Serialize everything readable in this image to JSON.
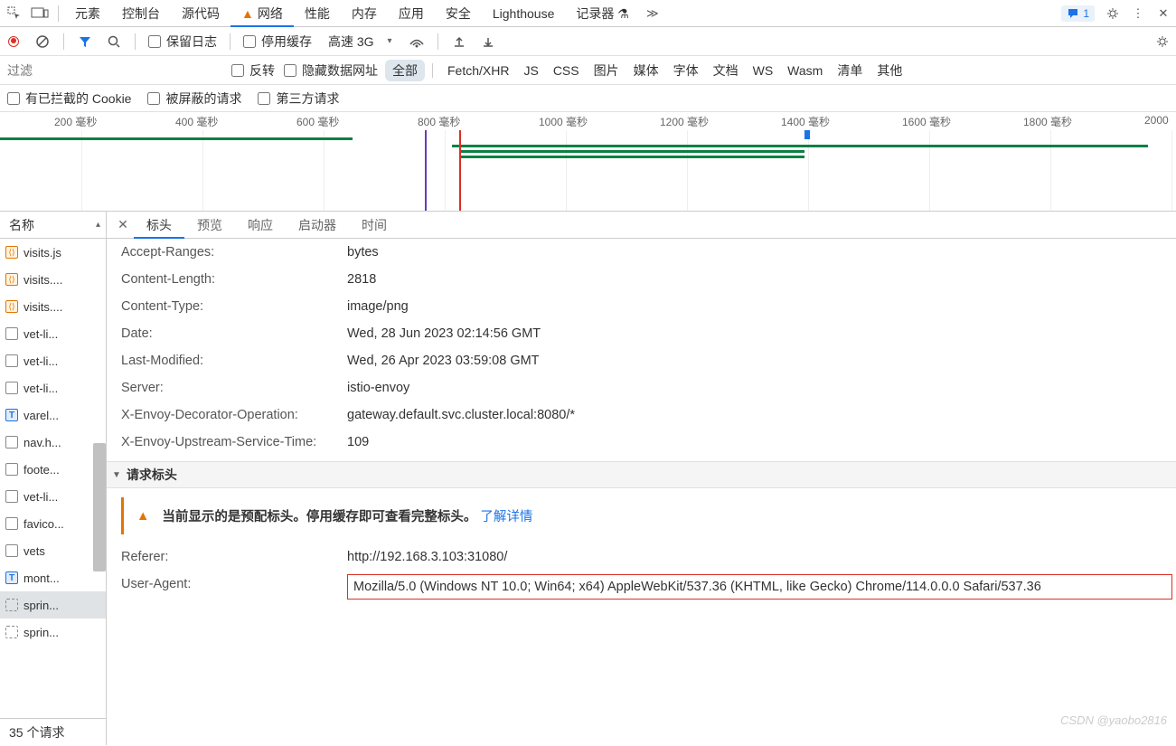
{
  "topTabs": {
    "items": [
      "元素",
      "控制台",
      "源代码",
      "网络",
      "性能",
      "内存",
      "应用",
      "安全",
      "Lighthouse",
      "记录器"
    ],
    "activeIndex": 3,
    "msgCount": "1"
  },
  "toolbar": {
    "preserveLog": "保留日志",
    "disableCache": "停用缓存",
    "throttle": "高速 3G"
  },
  "filterBar": {
    "placeholder": "过滤",
    "invert": "反转",
    "hideData": "隐藏数据网址",
    "types": [
      "全部",
      "Fetch/XHR",
      "JS",
      "CSS",
      "图片",
      "媒体",
      "字体",
      "文档",
      "WS",
      "Wasm",
      "清单",
      "其他"
    ],
    "activeType": 0
  },
  "cbRow": {
    "blockedCookies": "有已拦截的 Cookie",
    "blockedReq": "被屏蔽的请求",
    "thirdParty": "第三方请求"
  },
  "timeline": {
    "ticks": [
      "200 毫秒",
      "400 毫秒",
      "600 毫秒",
      "800 毫秒",
      "1000 毫秒",
      "1200 毫秒",
      "1400 毫秒",
      "1600 毫秒",
      "1800 毫秒",
      "2000"
    ]
  },
  "nameCol": {
    "header": "名称",
    "footer": "35 个请求",
    "items": [
      {
        "icon": "js",
        "label": "visits.js"
      },
      {
        "icon": "js",
        "label": "visits...."
      },
      {
        "icon": "js",
        "label": "visits...."
      },
      {
        "icon": "css",
        "label": "vet-li..."
      },
      {
        "icon": "css",
        "label": "vet-li..."
      },
      {
        "icon": "css",
        "label": "vet-li..."
      },
      {
        "icon": "txt",
        "label": "varel..."
      },
      {
        "icon": "css",
        "label": "nav.h..."
      },
      {
        "icon": "css",
        "label": "foote..."
      },
      {
        "icon": "css",
        "label": "vet-li..."
      },
      {
        "icon": "css",
        "label": "favico..."
      },
      {
        "icon": "css",
        "label": "vets"
      },
      {
        "icon": "txt",
        "label": "mont..."
      },
      {
        "icon": "img",
        "label": "sprin...",
        "sel": true
      },
      {
        "icon": "img",
        "label": "sprin..."
      }
    ]
  },
  "detail": {
    "tabs": [
      "标头",
      "预览",
      "响应",
      "启动器",
      "时间"
    ],
    "activeTab": 0,
    "responseHeaders": [
      {
        "k": "Accept-Ranges:",
        "v": "bytes"
      },
      {
        "k": "Content-Length:",
        "v": "2818"
      },
      {
        "k": "Content-Type:",
        "v": "image/png"
      },
      {
        "k": "Date:",
        "v": "Wed, 28 Jun 2023 02:14:56 GMT"
      },
      {
        "k": "Last-Modified:",
        "v": "Wed, 26 Apr 2023 03:59:08 GMT"
      },
      {
        "k": "Server:",
        "v": "istio-envoy"
      },
      {
        "k": "X-Envoy-Decorator-Operation:",
        "v": "gateway.default.svc.cluster.local:8080/*"
      },
      {
        "k": "X-Envoy-Upstream-Service-Time:",
        "v": "109"
      }
    ],
    "reqHeaderSection": "请求标头",
    "warning": {
      "text": "当前显示的是预配标头。停用缓存即可查看完整标头。",
      "link": "了解详情"
    },
    "requestHeaders": [
      {
        "k": "Referer:",
        "v": "http://192.168.3.103:31080/"
      },
      {
        "k": "User-Agent:",
        "v": "Mozilla/5.0 (Windows NT 10.0; Win64; x64) AppleWebKit/537.36 (KHTML, like Gecko) Chrome/114.0.0.0 Safari/537.36",
        "hl": true
      }
    ]
  },
  "watermark": "CSDN @yaobo2816"
}
